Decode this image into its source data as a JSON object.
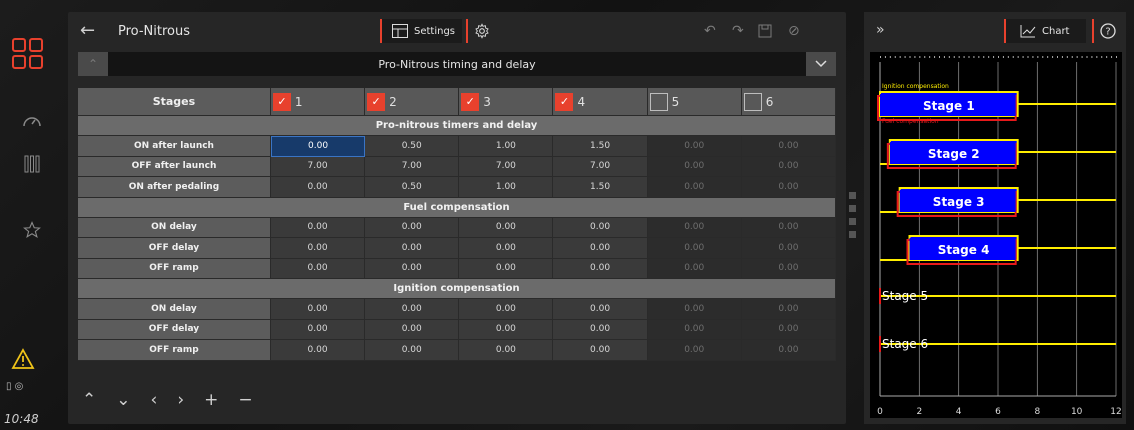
{
  "app": {
    "title": "Pro-Nitrous",
    "settings_label": "Settings",
    "chart_label": "Chart",
    "clock": "10:48",
    "status_icons": "▯ ◎"
  },
  "nav_icons": [
    "dashboard-gauge-icon",
    "columns-icon",
    "star-icon",
    "warning-icon"
  ],
  "section": {
    "title": "Pro-Nitrous timing and delay"
  },
  "table": {
    "stages_label": "Stages",
    "stages": [
      {
        "num": "1",
        "enabled": true
      },
      {
        "num": "2",
        "enabled": true
      },
      {
        "num": "3",
        "enabled": true
      },
      {
        "num": "4",
        "enabled": true
      },
      {
        "num": "5",
        "enabled": false
      },
      {
        "num": "6",
        "enabled": false
      }
    ],
    "groups": [
      {
        "title": "Pro-nitrous timers and delay",
        "rows": [
          {
            "label": "ON after launch",
            "values": [
              "0.00",
              "0.50",
              "1.00",
              "1.50",
              "0.00",
              "0.00"
            ]
          },
          {
            "label": "OFF after launch",
            "values": [
              "7.00",
              "7.00",
              "7.00",
              "7.00",
              "0.00",
              "0.00"
            ]
          },
          {
            "label": "ON after pedaling",
            "values": [
              "0.00",
              "0.50",
              "1.00",
              "1.50",
              "0.00",
              "0.00"
            ]
          }
        ]
      },
      {
        "title": "Fuel compensation",
        "rows": [
          {
            "label": "ON delay",
            "values": [
              "0.00",
              "0.00",
              "0.00",
              "0.00",
              "0.00",
              "0.00"
            ]
          },
          {
            "label": "OFF delay",
            "values": [
              "0.00",
              "0.00",
              "0.00",
              "0.00",
              "0.00",
              "0.00"
            ]
          },
          {
            "label": "OFF ramp",
            "values": [
              "0.00",
              "0.00",
              "0.00",
              "0.00",
              "0.00",
              "0.00"
            ]
          }
        ]
      },
      {
        "title": "Ignition compensation",
        "rows": [
          {
            "label": "ON delay",
            "values": [
              "0.00",
              "0.00",
              "0.00",
              "0.00",
              "0.00",
              "0.00"
            ]
          },
          {
            "label": "OFF delay",
            "values": [
              "0.00",
              "0.00",
              "0.00",
              "0.00",
              "0.00",
              "0.00"
            ]
          },
          {
            "label": "OFF ramp",
            "values": [
              "0.00",
              "0.00",
              "0.00",
              "0.00",
              "0.00",
              "0.00"
            ]
          }
        ]
      }
    ]
  },
  "chart_data": {
    "type": "timeline",
    "legend": [
      "Ignition compensation",
      "Fuel compensation"
    ],
    "x_ticks": [
      "0",
      "2",
      "4",
      "6",
      "8",
      "10",
      "12"
    ],
    "xlim": [
      0,
      12
    ],
    "series": [
      {
        "name": "Stage 1",
        "on": 0.0,
        "off": 7.0
      },
      {
        "name": "Stage 2",
        "on": 0.5,
        "off": 7.0
      },
      {
        "name": "Stage 3",
        "on": 1.0,
        "off": 7.0
      },
      {
        "name": "Stage 4",
        "on": 1.5,
        "off": 7.0
      },
      {
        "name": "Stage 5",
        "on": 0.0,
        "off": 0.0
      },
      {
        "name": "Stage 6",
        "on": 0.0,
        "off": 0.0
      }
    ],
    "colors": {
      "ignition": "#ffee00",
      "fuel": "#e8191a",
      "box": "#0000ff",
      "grid": "#888888"
    }
  }
}
